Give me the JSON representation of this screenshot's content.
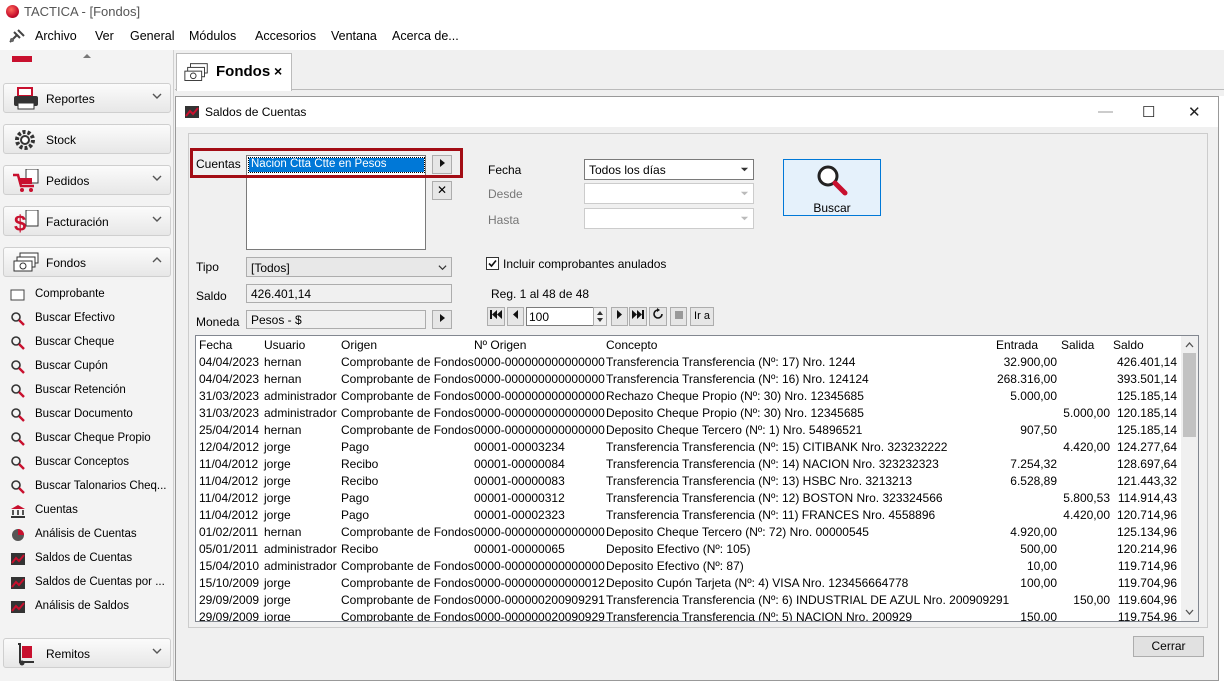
{
  "app": {
    "title": "TACTICA - [Fondos]"
  },
  "menu": [
    "Archivo",
    "Ver",
    "General",
    "Módulos",
    "Accesorios",
    "Ventana",
    "Acerca de..."
  ],
  "sidebar": {
    "groups": [
      {
        "label": "Reportes",
        "icon": "printer-icon"
      },
      {
        "label": "Stock",
        "icon": "gear-icon"
      },
      {
        "label": "Pedidos",
        "icon": "cart-icon"
      },
      {
        "label": "Facturación",
        "icon": "dollar-icon"
      },
      {
        "label": "Fondos",
        "icon": "money-icon"
      },
      {
        "label": "Remitos",
        "icon": "hand-truck-icon"
      }
    ],
    "items": [
      "Comprobante",
      "Buscar Efectivo",
      "Buscar Cheque",
      "Buscar Cupón",
      "Buscar Retención",
      "Buscar Documento",
      "Buscar Cheque Propio",
      "Buscar Conceptos",
      "Buscar Talonarios Cheq...",
      "Cuentas",
      "Análisis de Cuentas",
      "Saldos de Cuentas",
      "Saldos de Cuentas por ...",
      "Análisis de Saldos"
    ]
  },
  "tab": {
    "label": "Fondos",
    "close": "×"
  },
  "dialog": {
    "title": "Saldos de Cuentas",
    "controls": {
      "minimize": "—",
      "maximize": "☐",
      "close": "✕"
    },
    "form": {
      "cuentas_label": "Cuentas",
      "cuentas_selected": "Nacion Ctta Ctte en Pesos",
      "remove": "✕",
      "tipo_label": "Tipo",
      "tipo_value": "[Todos]",
      "saldo_label": "Saldo",
      "saldo_value": "426.401,14",
      "moneda_label": "Moneda",
      "moneda_value": "Pesos - $",
      "fecha_label": "Fecha",
      "fecha_value": "Todos los días",
      "desde_label": "Desde",
      "hasta_label": "Hasta",
      "incluir_label": "Incluir comprobantes anulados",
      "incluir_checked": true,
      "reg_text": "Reg. 1 al 48 de 48",
      "page_size": "100",
      "ira_label": "Ir a",
      "buscar_label": "Buscar"
    },
    "grid": {
      "columns": [
        "Fecha",
        "Usuario",
        "Origen",
        "Nº Origen",
        "Concepto",
        "Entrada",
        "Salida",
        "Saldo"
      ],
      "rows": [
        [
          "04/04/2023",
          "hernan",
          "Comprobante de Fondos",
          "0000-000000000000000",
          "Transferencia Transferencia (Nº: 17)  Nro. 1244",
          "32.900,00",
          "",
          "426.401,14"
        ],
        [
          "04/04/2023",
          "hernan",
          "Comprobante de Fondos",
          "0000-000000000000000",
          "Transferencia Transferencia (Nº: 16)  Nro. 124124",
          "268.316,00",
          "",
          "393.501,14"
        ],
        [
          "31/03/2023",
          "administrador",
          "Comprobante de Fondos",
          "0000-000000000000000",
          "Rechazo Cheque Propio (Nº: 30) Nro. 12345685",
          "5.000,00",
          "",
          "125.185,14"
        ],
        [
          "31/03/2023",
          "administrador",
          "Comprobante de Fondos",
          "0000-000000000000000",
          "Deposito Cheque Propio (Nº: 30) Nro. 12345685",
          "",
          "5.000,00",
          "120.185,14"
        ],
        [
          "25/04/2014",
          "hernan",
          "Comprobante de Fondos",
          "0000-000000000000000",
          "Deposito Cheque Tercero (Nº: 1) Nro. 54896521",
          "907,50",
          "",
          "125.185,14"
        ],
        [
          "12/04/2012",
          "jorge",
          "Pago",
          "00001-00003234",
          "Transferencia Transferencia (Nº: 15) CITIBANK Nro. 323232222",
          "",
          "4.420,00",
          "124.277,64"
        ],
        [
          "11/04/2012",
          "jorge",
          "Recibo",
          "00001-00000084",
          "Transferencia Transferencia (Nº: 14) NACION Nro. 323232323",
          "7.254,32",
          "",
          "128.697,64"
        ],
        [
          "11/04/2012",
          "jorge",
          "Recibo",
          "00001-00000083",
          "Transferencia Transferencia (Nº: 13) HSBC Nro. 3213213",
          "6.528,89",
          "",
          "121.443,32"
        ],
        [
          "11/04/2012",
          "jorge",
          "Pago",
          "00001-00000312",
          "Transferencia Transferencia (Nº: 12) BOSTON Nro. 323324566",
          "",
          "5.800,53",
          "114.914,43"
        ],
        [
          "11/04/2012",
          "jorge",
          "Pago",
          "00001-00002323",
          "Transferencia Transferencia (Nº: 11) FRANCES Nro. 4558896",
          "",
          "4.420,00",
          "120.714,96"
        ],
        [
          "01/02/2011",
          "hernan",
          "Comprobante de Fondos",
          "0000-000000000000000",
          "Deposito Cheque Tercero (Nº: 72) Nro. 00000545",
          "4.920,00",
          "",
          "125.134,96"
        ],
        [
          "05/01/2011",
          "administrador",
          "Recibo",
          "00001-00000065",
          "Deposito Efectivo (Nº: 105)",
          "500,00",
          "",
          "120.214,96"
        ],
        [
          "15/04/2010",
          "administrador",
          "Comprobante de Fondos",
          "0000-000000000000000",
          "Deposito Efectivo (Nº: 87)",
          "10,00",
          "",
          "119.714,96"
        ],
        [
          "15/10/2009",
          "jorge",
          "Comprobante de Fondos",
          "0000-000000000000012",
          "Deposito Cupón Tarjeta (Nº: 4) VISA Nro. 123456664778",
          "100,00",
          "",
          "119.704,96"
        ],
        [
          "29/09/2009",
          "jorge",
          "Comprobante de Fondos",
          "0000-000000200909291",
          "Transferencia Transferencia (Nº: 6) INDUSTRIAL DE AZUL Nro. 200909291",
          "",
          "150,00",
          "119.604,96"
        ],
        [
          "29/09/2009",
          "jorge",
          "Comprobante de Fondos",
          "0000-000000020090929",
          "Transferencia Transferencia (Nº: 5) NACION Nro. 200929",
          "150,00",
          "",
          "119.754,96"
        ]
      ]
    },
    "cerrar_label": "Cerrar"
  }
}
